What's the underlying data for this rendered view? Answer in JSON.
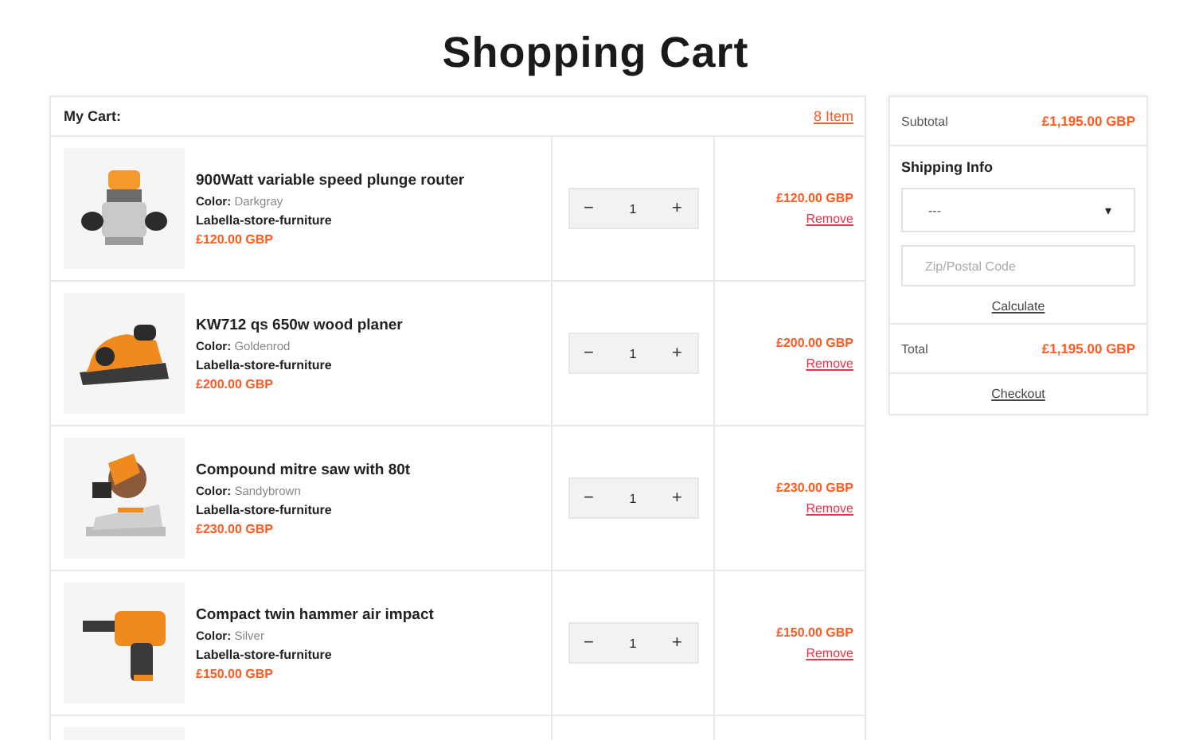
{
  "page_title": "Shopping Cart",
  "cart": {
    "heading": "My Cart:",
    "item_count": "8 Item",
    "items": [
      {
        "kind": "item",
        "name": "900Watt variable speed plunge router",
        "color_label": "Color:",
        "color_name": "Darkgray",
        "vendor": "Labella-store-furniture",
        "price": "£120.00 GBP",
        "minus": "−",
        "qty": "1",
        "plus": "+",
        "line_total": "£120.00 GBP",
        "remove": "Remove"
      },
      {
        "kind": "item",
        "name": "KW712 qs 650w wood planer",
        "color_label": "Color:",
        "color_name": "Goldenrod",
        "vendor": "Labella-store-furniture",
        "price": "£200.00 GBP",
        "minus": "−",
        "qty": "1",
        "plus": "+",
        "line_total": "£200.00 GBP",
        "remove": "Remove"
      },
      {
        "kind": "item",
        "name": "Compound mitre saw with 80t",
        "color_label": "Color:",
        "color_name": "Sandybrown",
        "vendor": "Labella-store-furniture",
        "price": "£230.00 GBP",
        "minus": "−",
        "qty": "1",
        "plus": "+",
        "line_total": "£230.00 GBP",
        "remove": "Remove"
      },
      {
        "kind": "item",
        "name": "Compact twin hammer air impact",
        "color_label": "Color:",
        "color_name": "Silver",
        "vendor": "Labella-store-furniture",
        "price": "£150.00 GBP",
        "minus": "−",
        "qty": "1",
        "plus": "+",
        "line_total": "£150.00 GBP",
        "remove": "Remove"
      },
      {
        "kind": "cut_off"
      }
    ]
  },
  "summary": {
    "subtotal_label": "Subtotal",
    "subtotal": "£1,195.00 GBP",
    "shipping_heading": "Shipping Info",
    "country_select": "---",
    "select_caret": "▾",
    "zip_placeholder": "Zip/Postal Code",
    "calculate": "Calculate",
    "total_label": "Total",
    "total": "£1,195.00 GBP",
    "checkout": "Checkout"
  }
}
